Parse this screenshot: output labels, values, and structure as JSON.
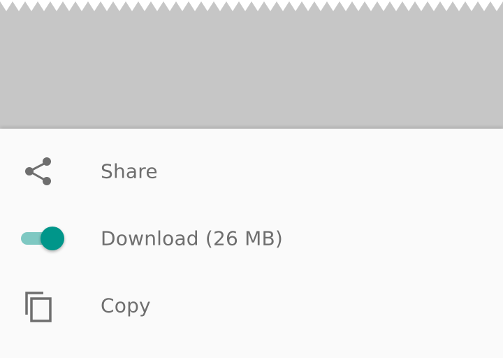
{
  "sheet": {
    "items": [
      {
        "label": "Share",
        "icon": "share-icon"
      },
      {
        "label": "Download (26 MB)",
        "icon": "toggle-switch",
        "toggle_on": true
      },
      {
        "label": "Copy",
        "icon": "copy-icon"
      }
    ]
  },
  "colors": {
    "scrim": "#c6c6c6",
    "sheet_background": "#fafafa",
    "label_text": "#6e6e6e",
    "icon": "#6e6e6e",
    "accent": "#00968a",
    "toggle_track": "#7ec8c2"
  }
}
